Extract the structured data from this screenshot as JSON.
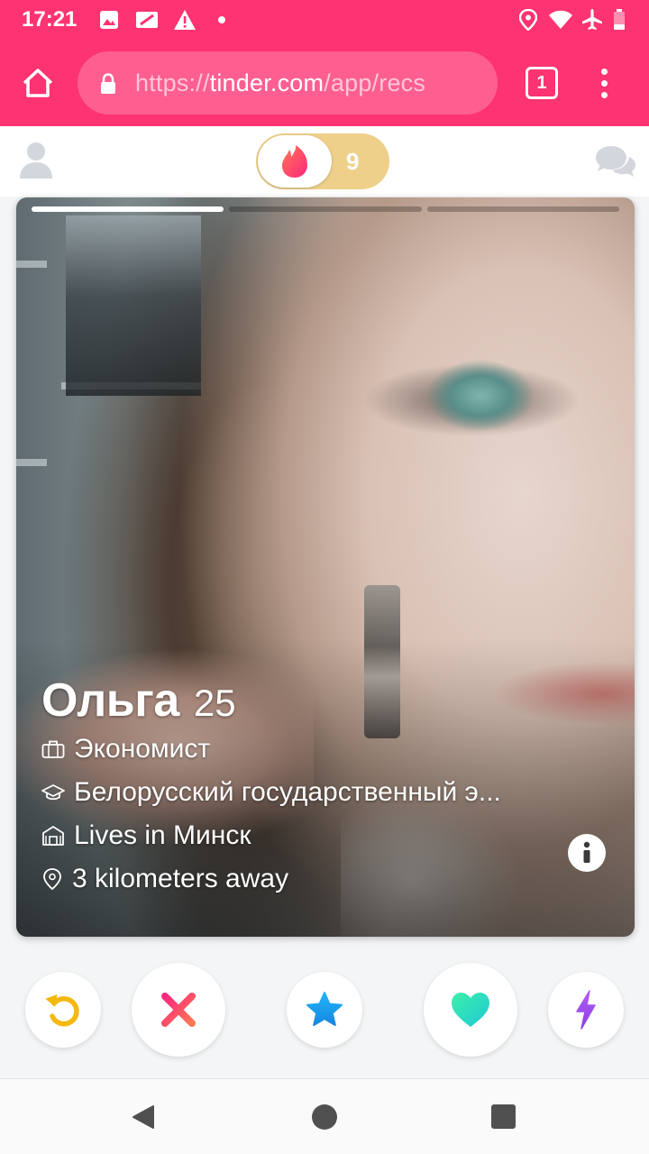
{
  "status_bar": {
    "time": "17:21",
    "icons": [
      "image-icon",
      "signal-off-icon",
      "warning-icon",
      "dot-icon",
      "location-icon",
      "wifi-icon",
      "airplane-icon",
      "battery-low-icon"
    ]
  },
  "browser": {
    "url_scheme": "https://",
    "url_host": "tinder.com",
    "url_path": "/app/recs",
    "tab_count": "1"
  },
  "header": {
    "boost_count": "9"
  },
  "card": {
    "photo_count": 3,
    "active_photo_index": 0,
    "name": "Ольга",
    "age": "25",
    "job": "Экономист",
    "school": "Белорусский государственный экономический университет",
    "school_display": "Белорусский государственный э...",
    "lives_in": "Lives in Минск",
    "distance": "3 kilometers away"
  },
  "actions": [
    {
      "name": "rewind",
      "color": "#f5b80f"
    },
    {
      "name": "nope",
      "color": "#fd5068"
    },
    {
      "name": "super-like",
      "color": "#1fa6ef"
    },
    {
      "name": "like",
      "color": "#1de9b6"
    },
    {
      "name": "boost",
      "color": "#a84ff0"
    }
  ],
  "colors": {
    "brand": "#fe3371",
    "boost_bg": "#eed08a"
  }
}
